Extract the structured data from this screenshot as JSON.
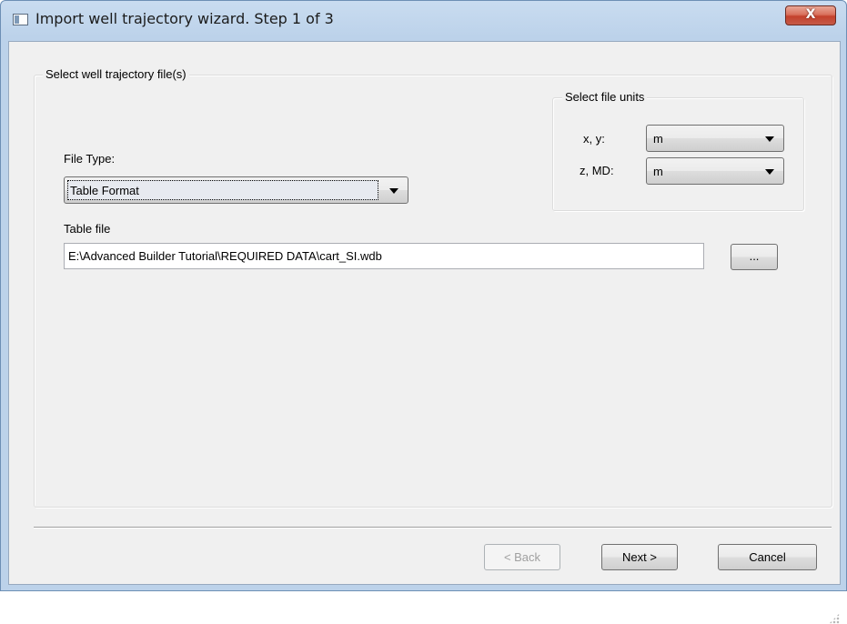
{
  "window": {
    "title": "Import well trajectory wizard. Step 1 of 3",
    "close_glyph": "X",
    "icon": "window-icon"
  },
  "file_group": {
    "legend": "Select well trajectory file(s)",
    "file_type_label": "File Type:",
    "file_type_value": "Table Format",
    "table_file_label": "Table file",
    "table_file_value": "E:\\Advanced Builder Tutorial\\REQUIRED DATA\\cart_SI.wdb",
    "browse_label": "..."
  },
  "units_group": {
    "legend": "Select file units",
    "xy_label": "x, y:",
    "xy_value": "m",
    "zmd_label": "z, MD:",
    "zmd_value": "m"
  },
  "footer": {
    "back_label": "< Back",
    "next_label": "Next >",
    "cancel_label": "Cancel"
  },
  "colors": {
    "frame": "#bcd2ea",
    "client": "#f0f0f0",
    "close_button": "#c4412c"
  }
}
